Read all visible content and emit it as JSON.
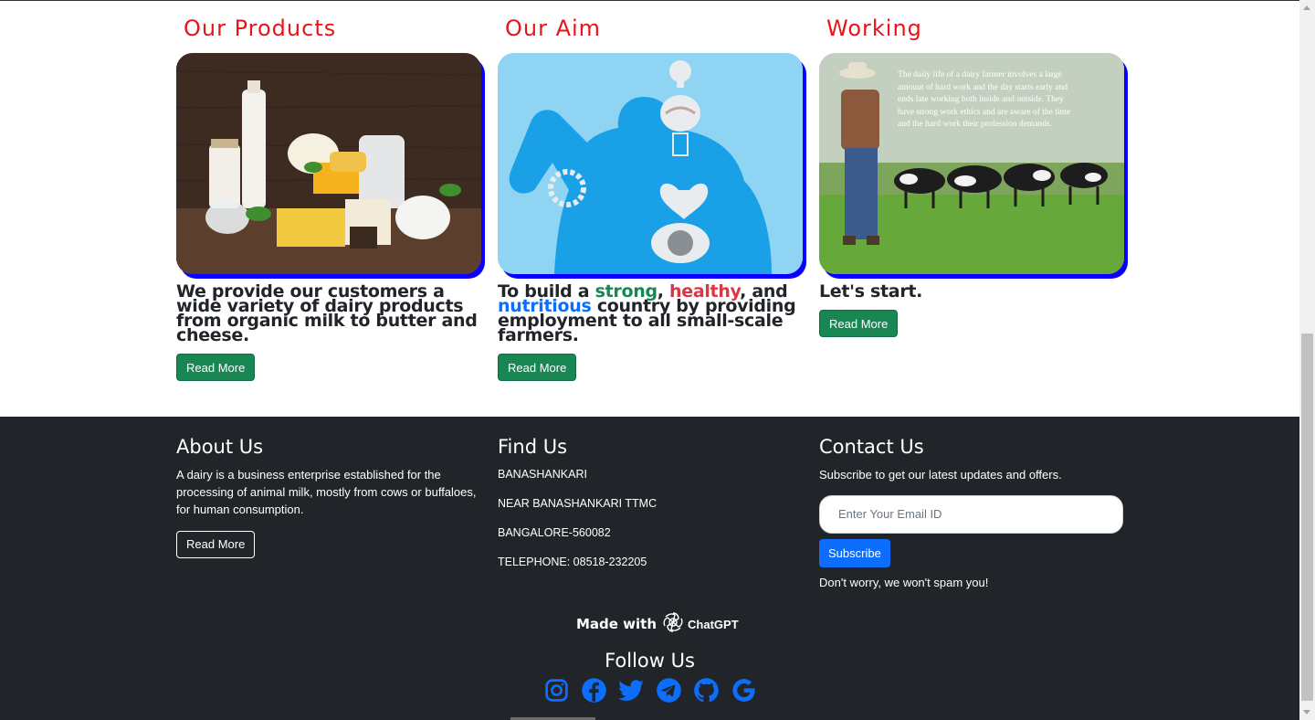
{
  "cards": [
    {
      "heading": "Our Products",
      "text": "We provide our customers a wide variety of dairy products from organic milk to butter and cheese.",
      "button": "Read More"
    },
    {
      "heading": "Our Aim",
      "text_parts": [
        "To build a ",
        "strong",
        ", ",
        "healthy",
        ", and ",
        "nutritious",
        " country by providing employment to all small-scale farmers."
      ],
      "button": "Read More"
    },
    {
      "heading": "Working",
      "image_caption": "The daily life of a dairy farmer involves a large amount of hard work and the day starts early and ends late working both inside and outside. They have strong work ethics and are aware of the time and the hard work their profession demands.",
      "text": "Let's start.",
      "button": "Read More"
    }
  ],
  "footer": {
    "about": {
      "title": "About Us",
      "text": "A dairy is a business enterprise established for the processing of animal milk, mostly from cows or buffaloes, for human consumption.",
      "button": "Read More"
    },
    "find": {
      "title": "Find Us",
      "lines": [
        "BANASHANKARI",
        "NEAR BANASHANKARI TTMC",
        "BANGALORE-560082",
        "TELEPHONE: 08518-232205"
      ]
    },
    "contact": {
      "title": "Contact Us",
      "text": "Subscribe to get our latest updates and offers.",
      "email_placeholder": "Enter Your Email ID",
      "button": "Subscribe",
      "note": "Don't worry, we won't spam you!"
    },
    "made_with": "Made with",
    "made_with_brand": "ChatGPT",
    "follow_title": "Follow Us",
    "social_icons": [
      "instagram-icon",
      "facebook-icon",
      "twitter-icon",
      "telegram-icon",
      "github-icon",
      "google-icon"
    ]
  },
  "colors": {
    "heading_red": "#e8141a",
    "accent_green": "#198754",
    "accent_red": "#dc3545",
    "accent_blue": "#0d6efd",
    "shadow_blue": "#0b00ff",
    "footer_bg": "#212529"
  }
}
